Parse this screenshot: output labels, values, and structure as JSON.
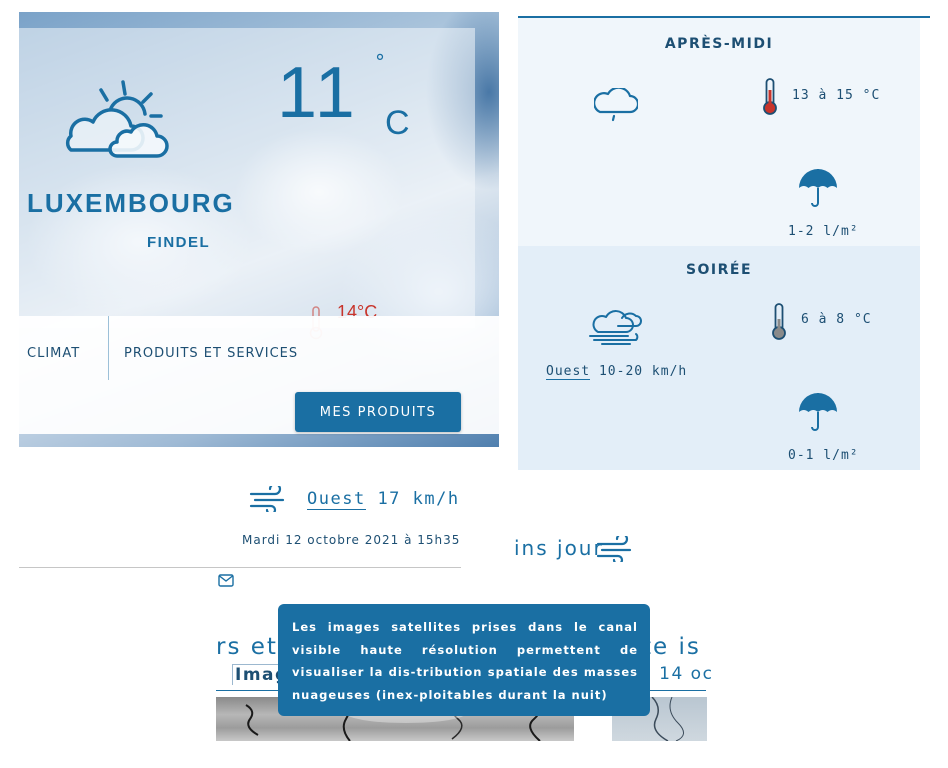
{
  "current": {
    "temperature": "11",
    "degree_symbol": "°",
    "unit": "C",
    "city": "LUXEMBOURG",
    "station": "FINDEL",
    "max_temp": "14°C",
    "weather_icon": "sun-behind-clouds-icon"
  },
  "nav": {
    "items": [
      {
        "label": "CLIMAT"
      },
      {
        "label": "PRODUITS ET SERVICES"
      }
    ],
    "products_button": "MES PRODUITS"
  },
  "forecast": {
    "afternoon": {
      "title": "APRÈS-MIDI",
      "temp_range": "13 à 15 °C",
      "precip": "1-2 l/m²",
      "weather_icon": "light-rain-cloud-icon"
    },
    "evening": {
      "title": "SOIRÉE",
      "temp_range": "6 à 8 °C",
      "precip": "0-1 l/m²",
      "wind_direction": "Ouest",
      "wind_speed": "10-20 km/h",
      "weather_icon": "windy-clouds-icon"
    }
  },
  "wind": {
    "direction": "Ouest",
    "speed": "17 km/h"
  },
  "observation_date": "Mardi 12 octobre 2021 à 15h35",
  "upcoming": {
    "heading_fragment": "ins jour"
  },
  "satellite": {
    "heading_left": "rs et",
    "heading_right": "te is",
    "tab_label": "Imag",
    "date_fragment": "i 14 oc",
    "tooltip": "Les images satellites prises dans le canal visible haute résolution permettent de visualiser la dis-tribution spatiale des masses nuageuses (inex-ploitables durant la nuit)"
  },
  "colors": {
    "primary": "#1a6fa3",
    "dark_text": "#1d4f73",
    "max_temp": "#c8342b",
    "panel_light": "#f0f6fb",
    "panel_mid": "#e3eef8"
  }
}
